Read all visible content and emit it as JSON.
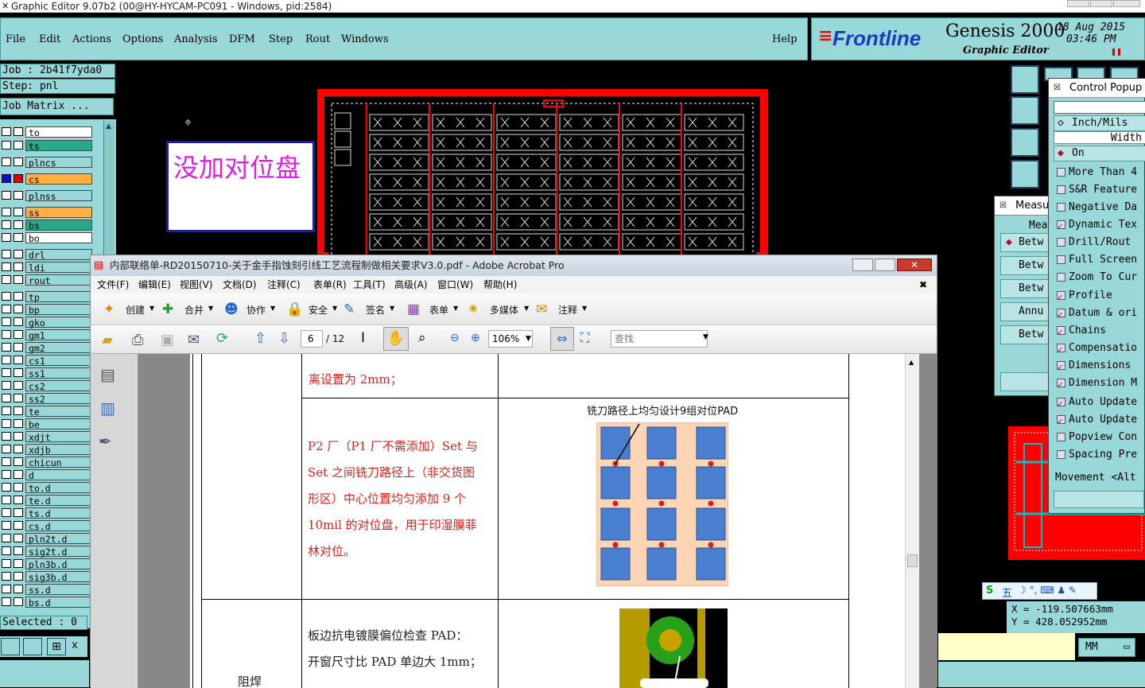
{
  "window": {
    "title": "Graphic Editor 9.07b2 (00@HY-HYCAM-PC091 - Windows, pid:2584)"
  },
  "menu": [
    "File",
    "Edit",
    "Actions",
    "Options",
    "Analysis",
    "DFM",
    "Step",
    "Rout",
    "Windows"
  ],
  "help_label": "Help",
  "brand": {
    "logo": "Frontline",
    "product": "Genesis 2000",
    "subtitle": "Graphic Editor",
    "date": "18 Aug 2015",
    "time": "03:46 PM"
  },
  "job": {
    "job": "Job : 2b41f7yda0",
    "step": "Step: pnl",
    "matrix": "Job Matrix ..."
  },
  "layers": [
    {
      "name": "to",
      "color": "#ffffff"
    },
    {
      "name": "ts",
      "color": "#2aa888"
    },
    {
      "name": "plncs",
      "color": "#99d8d8"
    },
    {
      "name": "cs",
      "color": "#ffb040"
    },
    {
      "name": "plnss",
      "color": "#99d8d8"
    },
    {
      "name": "ss",
      "color": "#ffb040"
    },
    {
      "name": "bs",
      "color": "#2aa888"
    },
    {
      "name": "bo",
      "color": "#ffffff"
    },
    {
      "name": "drl",
      "color": "#99d8d8"
    },
    {
      "name": "ldi",
      "color": "#99d8d8"
    },
    {
      "name": "rout",
      "color": "#99d8d8"
    },
    {
      "name": "tp",
      "color": "#99d8d8"
    },
    {
      "name": "bp",
      "color": "#99d8d8"
    },
    {
      "name": "gko",
      "color": "#99d8d8"
    },
    {
      "name": "gm1",
      "color": "#99d8d8"
    },
    {
      "name": "gm2",
      "color": "#99d8d8"
    },
    {
      "name": "cs1",
      "color": "#99d8d8"
    },
    {
      "name": "ss1",
      "color": "#99d8d8"
    },
    {
      "name": "cs2",
      "color": "#99d8d8"
    },
    {
      "name": "ss2",
      "color": "#99d8d8"
    },
    {
      "name": "te",
      "color": "#99d8d8"
    },
    {
      "name": "be",
      "color": "#99d8d8"
    },
    {
      "name": "xdjt",
      "color": "#99d8d8"
    },
    {
      "name": "xdjb",
      "color": "#99d8d8"
    },
    {
      "name": "chicun",
      "color": "#99d8d8"
    },
    {
      "name": "d",
      "color": "#99d8d8"
    },
    {
      "name": "to.d",
      "color": "#99d8d8"
    },
    {
      "name": "te.d",
      "color": "#99d8d8"
    },
    {
      "name": "ts.d",
      "color": "#99d8d8"
    },
    {
      "name": "cs.d",
      "color": "#99d8d8"
    },
    {
      "name": "pln2t.d",
      "color": "#99d8d8"
    },
    {
      "name": "sig2t.d",
      "color": "#99d8d8"
    },
    {
      "name": "pln3b.d",
      "color": "#99d8d8"
    },
    {
      "name": "sig3b.d",
      "color": "#99d8d8"
    },
    {
      "name": "ss.d",
      "color": "#99d8d8"
    },
    {
      "name": "bs.d",
      "color": "#99d8d8"
    }
  ],
  "selected": "Selected : 0",
  "annotation": "没加对位盘",
  "acrobat": {
    "title": "内部联络单-RD20150710-关于金手指蚀刻引线工艺流程制做相关要求V3.0.pdf - Adobe Acrobat Pro",
    "menu": [
      "文件(F)",
      "编辑(E)",
      "视图(V)",
      "文档(D)",
      "注释(C)",
      "表单(R)",
      "工具(T)",
      "高级(A)",
      "窗口(W)",
      "帮助(H)"
    ],
    "toolbar": [
      "创建",
      "合并",
      "协作",
      "安全",
      "签名",
      "表单",
      "多媒体",
      "注释"
    ],
    "page": "6",
    "pages": "/ 12",
    "zoom": "106%",
    "search_placeholder": "查找",
    "row1_text": "离设置为 2mm；",
    "row2_lines": [
      "P2 厂（P1 厂不需添加）Set 与",
      "Set 之间铣刀路径上（非交货图",
      "形区）中心位置均匀添加 9 个",
      "10mil 的对位盘，用于印湿膜菲",
      "林对位。"
    ],
    "figure_caption": "铣刀路径上均匀设计9组对位PAD",
    "row3_lines": [
      "板边抗电镀膜偏位检查 PAD：",
      "开窗尺寸比 PAD 单边大 1mm；"
    ],
    "row3_label": "阻焊"
  },
  "control_popup": {
    "title": "Control Popup",
    "unit": "Inch/Mils",
    "width": "Width",
    "on": "On",
    "items": [
      {
        "label": "More Than 4",
        "checked": false
      },
      {
        "label": "S&R Feature",
        "checked": false
      },
      {
        "label": "Negative Da",
        "checked": false
      },
      {
        "label": "Dynamic Tex",
        "checked": true
      },
      {
        "label": "Drill/Rout",
        "checked": false
      },
      {
        "label": "Full Screen",
        "checked": false
      },
      {
        "label": "Zoom To Cur",
        "checked": false
      },
      {
        "label": "Profile",
        "checked": true
      },
      {
        "label": "Datum & ori",
        "checked": true
      },
      {
        "label": "Chains",
        "checked": true
      },
      {
        "label": "Compensatio",
        "checked": true
      },
      {
        "label": "Dimensions",
        "checked": true
      },
      {
        "label": "Dimension M",
        "checked": true
      },
      {
        "label": "Auto Update",
        "checked": true
      },
      {
        "label": "Auto Update",
        "checked": true
      },
      {
        "label": "Popview Con",
        "checked": false
      },
      {
        "label": "Spacing Pre",
        "checked": false
      }
    ],
    "movement": "Movement <Alt"
  },
  "measure": {
    "title": "Measu",
    "header": "Mea",
    "buttons": [
      "Betw",
      "Betw",
      "Betw",
      "Annu",
      "Betw"
    ]
  },
  "coords": {
    "x": "X  =  -119.507663mm",
    "y": "Y  =  428.052952mm"
  },
  "units": "MM",
  "ime": "五"
}
